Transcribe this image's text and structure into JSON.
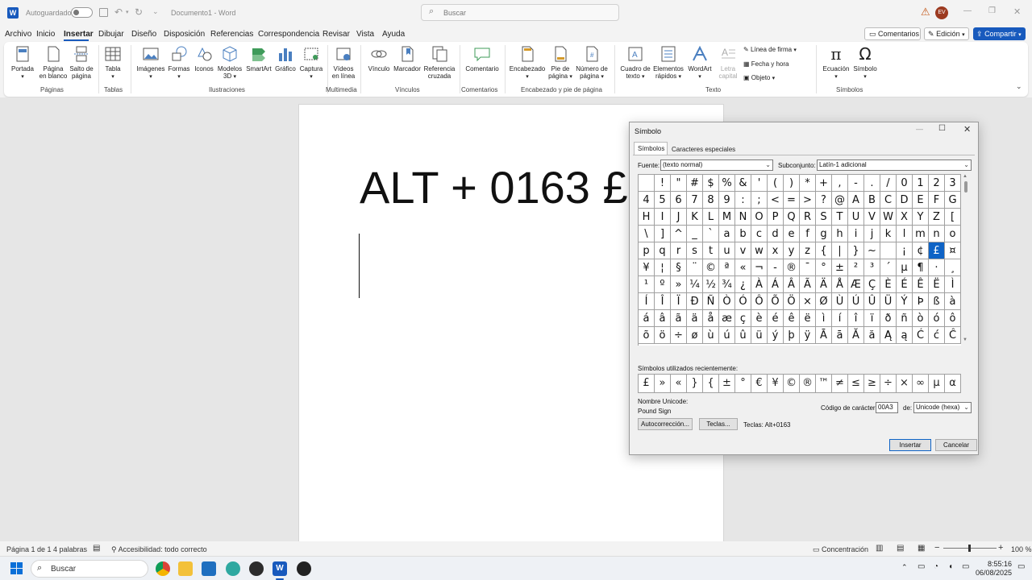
{
  "titlebar": {
    "autosave": "Autoguardado",
    "document_title": "Documento1",
    "app_name": "Word",
    "search_placeholder": "Buscar",
    "user_initials": "EV"
  },
  "menu": [
    "Archivo",
    "Inicio",
    "Insertar",
    "Dibujar",
    "Diseño",
    "Disposición",
    "Referencias",
    "Correspondencia",
    "Revisar",
    "Vista",
    "Ayuda"
  ],
  "menu_active": "Insertar",
  "menu_right": {
    "comments": "Comentarios",
    "editing": "Edición",
    "share": "Compartir"
  },
  "ribbon": {
    "portada": "Portada",
    "pagina_blanco": [
      "Página",
      "en blanco"
    ],
    "salto_pagina": [
      "Salto de",
      "página"
    ],
    "tabla": "Tabla",
    "imagenes": "Imágenes",
    "formas": "Formas",
    "iconos": "Iconos",
    "modelos": [
      "Modelos",
      "3D"
    ],
    "smartart": "SmartArt",
    "grafico": "Gráfico",
    "captura": "Captura",
    "videos": [
      "Vídeos",
      "en línea"
    ],
    "vinculo": "Vínculo",
    "marcador": "Marcador",
    "referencia": [
      "Referencia",
      "cruzada"
    ],
    "comentario": "Comentario",
    "encabezado": "Encabezado",
    "pie": [
      "Pie de",
      "página"
    ],
    "numero": [
      "Número de",
      "página"
    ],
    "cuadro": [
      "Cuadro de",
      "texto"
    ],
    "elementos": [
      "Elementos",
      "rápidos"
    ],
    "wordart": "WordArt",
    "letra": [
      "Letra",
      "capital"
    ],
    "linea_firma": "Línea de firma",
    "fecha_hora": "Fecha y hora",
    "objeto": "Objeto",
    "ecuacion": "Ecuación",
    "simbolo": "Símbolo",
    "groups": {
      "paginas": "Páginas",
      "tablas": "Tablas",
      "ilustraciones": "Ilustraciones",
      "multimedia": "Multimedia",
      "vinculos": "Vínculos",
      "comentarios": "Comentarios",
      "encabezado": "Encabezado y pie de página",
      "texto": "Texto",
      "simbolos": "Símbolos"
    }
  },
  "document": {
    "text": "ALT + 0163 £"
  },
  "dialog": {
    "title": "Símbolo",
    "tab_symbols": "Símbolos",
    "tab_special": "Caracteres especiales",
    "font_label": "Fuente:",
    "font_value": "(texto normal)",
    "subset_label": "Subconjunto:",
    "subset_value": "Latín-1 adicional",
    "grid": [
      [
        "",
        "!",
        "\"",
        "#",
        "$",
        "%",
        "&",
        "'",
        "(",
        ")",
        "*",
        "+",
        ",",
        "-",
        ".",
        "/",
        "0",
        "1",
        "2",
        "3"
      ],
      [
        "4",
        "5",
        "6",
        "7",
        "8",
        "9",
        ":",
        ";",
        "<",
        "=",
        ">",
        "?",
        "@",
        "A",
        "B",
        "C",
        "D",
        "E",
        "F",
        "G"
      ],
      [
        "H",
        "I",
        "J",
        "K",
        "L",
        "M",
        "N",
        "O",
        "P",
        "Q",
        "R",
        "S",
        "T",
        "U",
        "V",
        "W",
        "X",
        "Y",
        "Z",
        "["
      ],
      [
        "\\",
        "]",
        "^",
        "_",
        "`",
        "a",
        "b",
        "c",
        "d",
        "e",
        "f",
        "g",
        "h",
        "i",
        "j",
        "k",
        "l",
        "m",
        "n",
        "o"
      ],
      [
        "p",
        "q",
        "r",
        "s",
        "t",
        "u",
        "v",
        "w",
        "x",
        "y",
        "z",
        "{",
        "|",
        "}",
        "~",
        "",
        "¡",
        "¢",
        "£",
        "¤"
      ],
      [
        "¥",
        "¦",
        "§",
        "¨",
        "©",
        "ª",
        "«",
        "¬",
        "-",
        "®",
        "¯",
        "°",
        "±",
        "²",
        "³",
        "´",
        "µ",
        "¶",
        "·",
        "¸"
      ],
      [
        "¹",
        "º",
        "»",
        "¼",
        "½",
        "¾",
        "¿",
        "À",
        "Á",
        "Â",
        "Ã",
        "Ä",
        "Å",
        "Æ",
        "Ç",
        "È",
        "É",
        "Ê",
        "Ë",
        "Ì"
      ],
      [
        "Í",
        "Î",
        "Ï",
        "Ð",
        "Ñ",
        "Ò",
        "Ó",
        "Ô",
        "Õ",
        "Ö",
        "×",
        "Ø",
        "Ù",
        "Ú",
        "Û",
        "Ü",
        "Ý",
        "Þ",
        "ß",
        "à"
      ],
      [
        "á",
        "â",
        "ã",
        "ä",
        "å",
        "æ",
        "ç",
        "è",
        "é",
        "ê",
        "ë",
        "ì",
        "í",
        "î",
        "ï",
        "ð",
        "ñ",
        "ò",
        "ó",
        "ô"
      ],
      [
        "õ",
        "ö",
        "÷",
        "ø",
        "ù",
        "ú",
        "û",
        "ü",
        "ý",
        "þ",
        "ÿ",
        "Ā",
        "ā",
        "Ă",
        "ă",
        "Ą",
        "ą",
        "Ć",
        "ć",
        "Ĉ"
      ]
    ],
    "selected_char": "£",
    "recent_label": "Símbolos utilizados recientemente:",
    "recent": [
      "£",
      "»",
      "«",
      "}",
      "{",
      "±",
      "°",
      "€",
      "¥",
      "©",
      "®",
      "™",
      "≠",
      "≤",
      "≥",
      "÷",
      "×",
      "∞",
      "µ",
      "α"
    ],
    "unicode_name_label": "Nombre Unicode:",
    "unicode_name": "Pound Sign",
    "char_code_label": "Código de carácter:",
    "char_code": "00A3",
    "from_label": "de:",
    "from_value": "Unicode (hexa)",
    "autocorrect": "Autocorrección...",
    "keys_button": "Teclas...",
    "keys_text": "Teclas: Alt+0163",
    "insert": "Insertar",
    "cancel": "Cancelar"
  },
  "status": {
    "page": "Página 1 de 1",
    "words": "4 palabras",
    "accessibility": "Accesibilidad: todo correcto",
    "focus": "Concentración",
    "zoom": "100 %"
  },
  "taskbar": {
    "search": "Buscar",
    "time": "8:55:16",
    "date": "06/08/2025"
  }
}
